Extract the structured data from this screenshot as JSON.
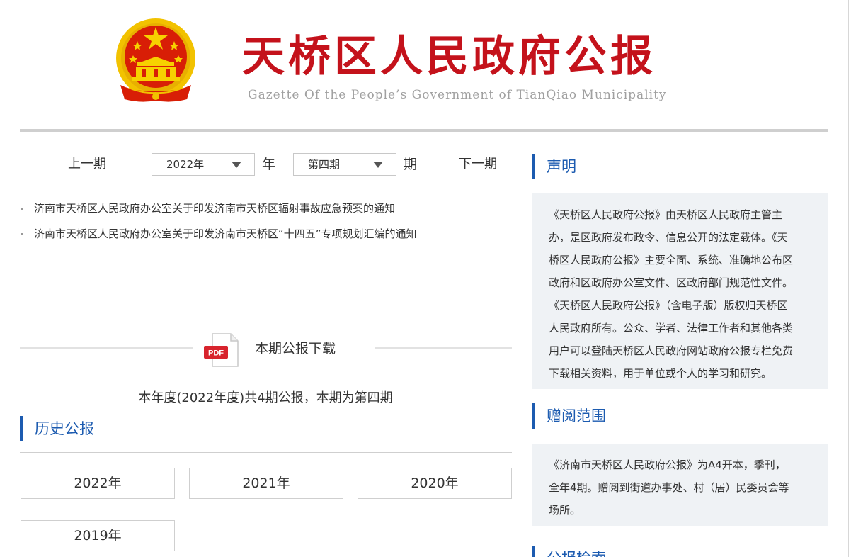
{
  "header": {
    "title": "天桥区人民政府公报",
    "subtitle": "Gazette Of the People’s Government of TianQiao Municipality",
    "emblem_icon": "national-emblem-icon",
    "colors": {
      "title_red": "#c4121b",
      "emblem_gold": "#f2c200",
      "emblem_red": "#d81e06"
    }
  },
  "issue_nav": {
    "prev_label": "上一期",
    "next_label": "下一期",
    "year_select_value": "2022年",
    "year_unit": "年",
    "issue_select_value": "第四期",
    "issue_unit": "期"
  },
  "documents": [
    {
      "title": "济南市天桥区人民政府办公室关于印发济南市天桥区辐射事故应急预案的通知"
    },
    {
      "title": "济南市天桥区人民政府办公室关于印发济南市天桥区“十四五”专项规划汇编的通知"
    }
  ],
  "download": {
    "icon": "pdf-icon",
    "pdf_badge": "PDF",
    "label": "本期公报下载"
  },
  "year_summary": "本年度(2022年度)共4期公报，本期为第四期",
  "history": {
    "title": "历史公报",
    "years": [
      "2022年",
      "2021年",
      "2020年",
      "2019年"
    ]
  },
  "sidebar": {
    "statement": {
      "title": "声明",
      "lines": [
        "《天桥区人民政府公报》由天桥区人民政府主管主",
        "办，是区政府发布政令、信息公开的法定载体。《天",
        "桥区人民政府公报》主要全面、系统、准确地公布区",
        "政府和区政府办公室文件、区政府部门规范性文件。",
        "《天桥区人民政府公报》（含电子版）版权归天桥区",
        "人民政府所有。公众、学者、法律工作者和其他各类",
        "用户可以登陆天桥区人民政府网站政府公报专栏免费",
        "下载相关资料，用于单位或个人的学习和研究。"
      ]
    },
    "distribution": {
      "title": "赠阅范围",
      "lines": [
        "《济南市天桥区人民政府公报》为A4开本，季刊，",
        "全年4期。赠阅到街道办事处、村（居）民委员会等",
        "场所。"
      ]
    },
    "next_section": {
      "title": "公报检索"
    }
  },
  "colors": {
    "accent_blue": "#1c5bb0",
    "panel_bg": "#eff2f5",
    "pdf_red": "#d8242d"
  }
}
